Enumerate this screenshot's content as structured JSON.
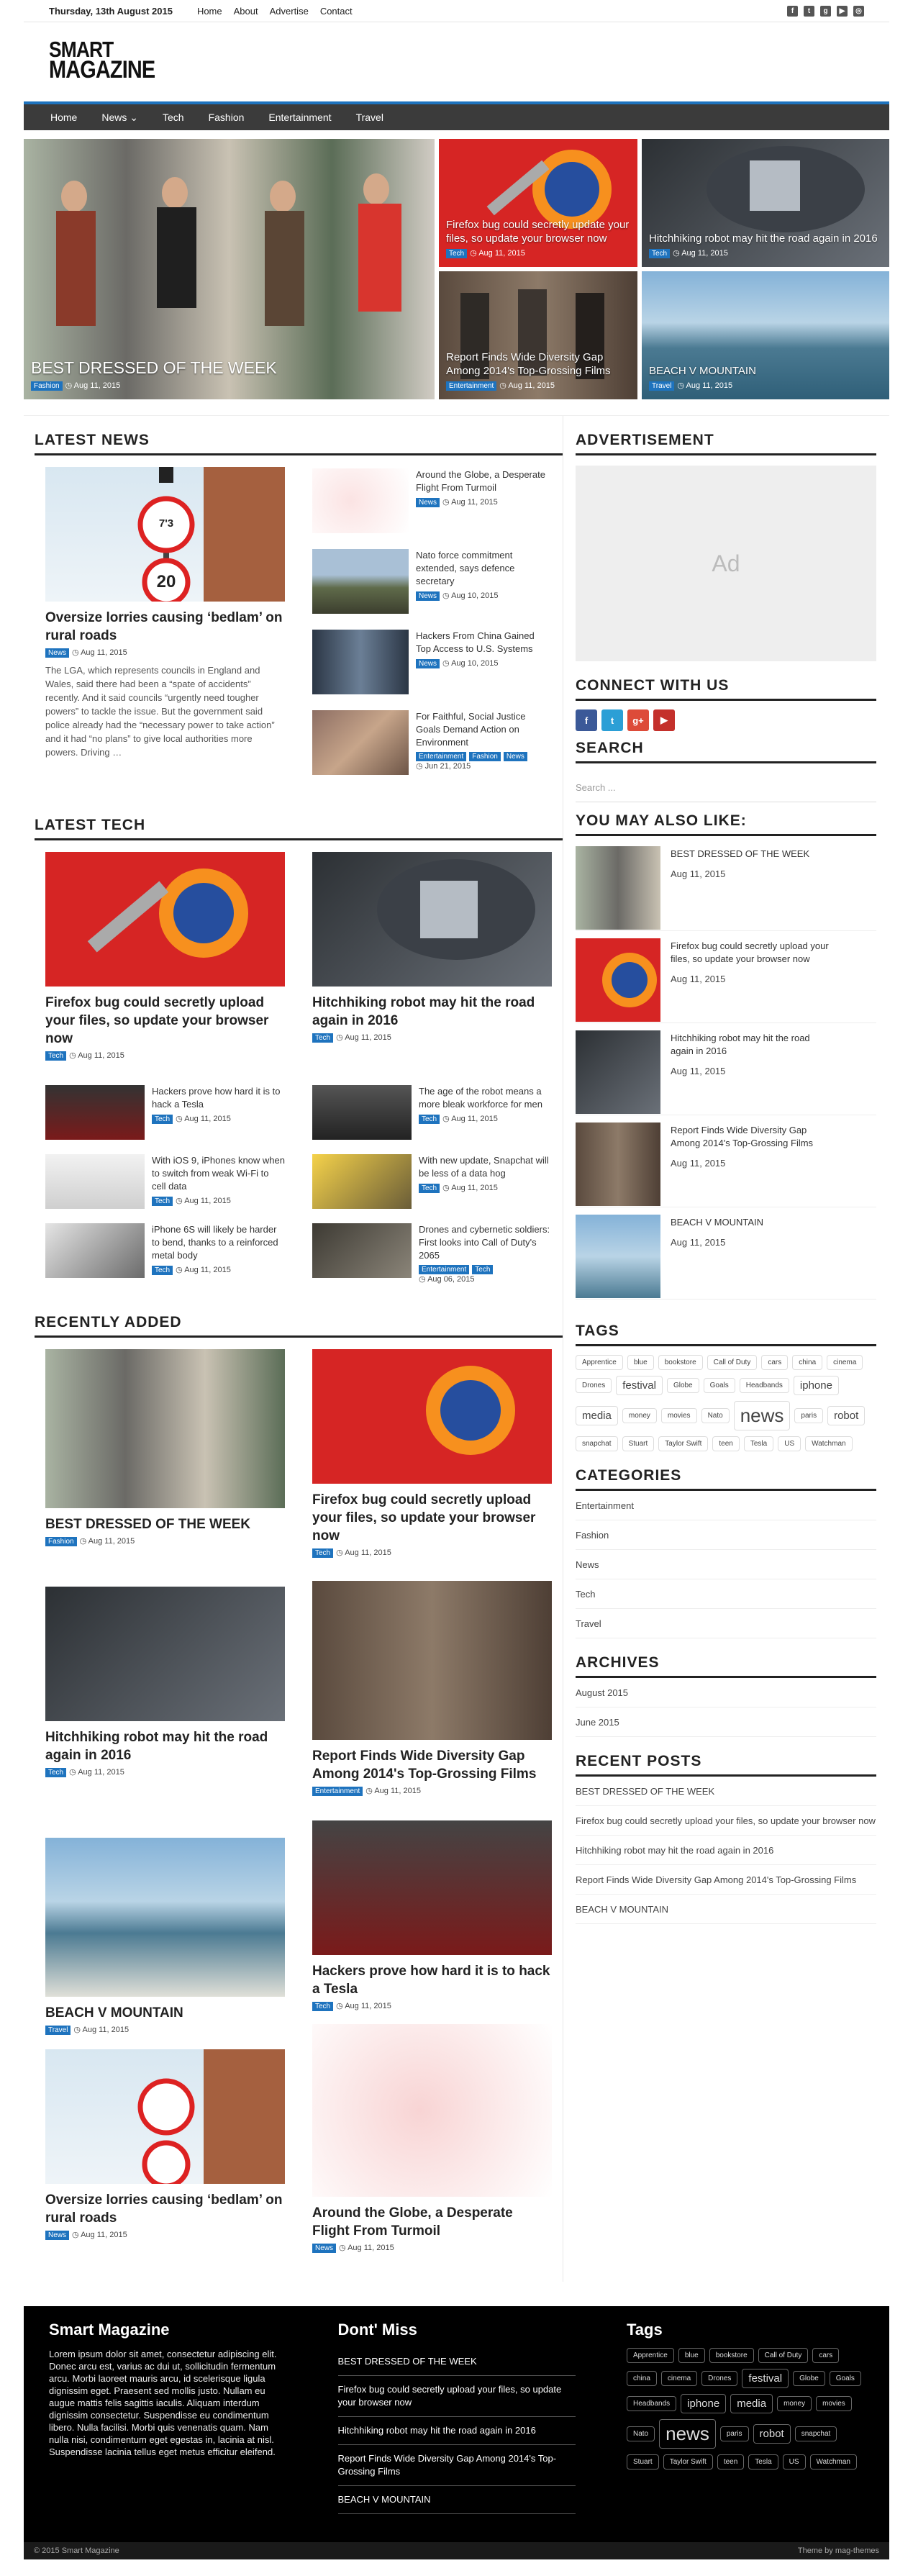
{
  "topbar": {
    "date": "Thursday, 13th August 2015",
    "links": [
      "Home",
      "About",
      "Advertise",
      "Contact"
    ],
    "social_icons": [
      "facebook-icon",
      "twitter-icon",
      "google-plus-icon",
      "youtube-icon",
      "instagram-icon"
    ]
  },
  "logo": {
    "line1": "SMART",
    "line2": "MAGAZINE"
  },
  "nav": {
    "items": [
      "Home",
      "News",
      "Tech",
      "Fashion",
      "Entertainment",
      "Travel"
    ],
    "dropdown_marker": "⌄"
  },
  "featured": [
    {
      "title": "BEST DRESSED OF THE WEEK",
      "tag": "Fashion",
      "date": "Aug 11, 2015"
    },
    {
      "title": "Firefox bug could secretly update your files, so update your browser now",
      "tag": "Tech",
      "date": "Aug 11, 2015"
    },
    {
      "title": "Hitchhiking robot may hit the road again in 2016",
      "tag": "Tech",
      "date": "Aug 11, 2015"
    },
    {
      "title": "Report Finds Wide Diversity Gap Among 2014's Top-Grossing Films",
      "tag": "Entertainment",
      "date": "Aug 11, 2015"
    },
    {
      "title": "BEACH V MOUNTAIN",
      "tag": "Travel",
      "date": "Aug 11, 2015"
    }
  ],
  "latest_news": {
    "title": "LATEST NEWS",
    "main": {
      "title": "Oversize lorries causing ‘bedlam’ on rural roads",
      "tag": "News",
      "date": "Aug 11, 2015",
      "excerpt": "The LGA, which represents councils in England and Wales, said there had been a “spate of accidents” recently. And it said councils “urgently need tougher powers” to tackle the issue. But the government said police already had the “necessary power to take action” and it had “no plans” to give local authorities more powers. Driving …",
      "sign_top": "7'3",
      "sign_bottom": "20"
    },
    "items": [
      {
        "title": "Around the Globe, a Desperate Flight From Turmoil",
        "tags": [
          "News"
        ],
        "date": "Aug 11, 2015"
      },
      {
        "title": "Nato force commitment extended, says defence secretary",
        "tags": [
          "News"
        ],
        "date": "Aug 10, 2015"
      },
      {
        "title": "Hackers From China Gained Top Access to U.S. Systems",
        "tags": [
          "News"
        ],
        "date": "Aug 10, 2015"
      },
      {
        "title": "For Faithful, Social Justice Goals Demand Action on Environment",
        "tags": [
          "Entertainment",
          "Fashion",
          "News"
        ],
        "date": "Jun 21, 2015"
      }
    ]
  },
  "latest_tech": {
    "title": "LATEST TECH",
    "main": [
      {
        "title": "Firefox bug could secretly upload your files, so update your browser now",
        "tag": "Tech",
        "date": "Aug 11, 2015"
      },
      {
        "title": "Hitchhiking robot may hit the road again in 2016",
        "tag": "Tech",
        "date": "Aug 11, 2015"
      }
    ],
    "left": [
      {
        "title": "Hackers prove how hard it is to hack a Tesla",
        "tags": [
          "Tech"
        ],
        "date": "Aug 11, 2015"
      },
      {
        "title": "With iOS 9, iPhones know when to switch from weak Wi-Fi to cell data",
        "tags": [
          "Tech"
        ],
        "date": "Aug 11, 2015"
      },
      {
        "title": "iPhone 6S will likely be harder to bend, thanks to a reinforced metal body",
        "tags": [
          "Tech"
        ],
        "date": "Aug 11, 2015"
      }
    ],
    "right": [
      {
        "title": "The age of the robot means a more bleak workforce for men",
        "tags": [
          "Tech"
        ],
        "date": "Aug 11, 2015"
      },
      {
        "title": "With new update, Snapchat will be less of a data hog",
        "tags": [
          "Tech"
        ],
        "date": "Aug 11, 2015"
      },
      {
        "title": "Drones and cybernetic soldiers: First looks into Call of Duty's 2065",
        "tags": [
          "Entertainment",
          "Tech"
        ],
        "date": "Aug 06, 2015"
      }
    ]
  },
  "recently_added": {
    "title": "RECENTLY ADDED",
    "items": [
      {
        "title": "BEST DRESSED OF THE WEEK",
        "tag": "Fashion",
        "date": "Aug 11, 2015"
      },
      {
        "title": "Firefox bug could secretly upload your files, so update your browser now",
        "tag": "Tech",
        "date": "Aug 11, 2015"
      },
      {
        "title": "Hitchhiking robot may hit the road again in 2016",
        "tag": "Tech",
        "date": "Aug 11, 2015"
      },
      {
        "title": "Report Finds Wide Diversity Gap Among 2014's Top-Grossing Films",
        "tag": "Entertainment",
        "date": "Aug 11, 2015"
      },
      {
        "title": "BEACH V MOUNTAIN",
        "tag": "Travel",
        "date": "Aug 11, 2015"
      },
      {
        "title": "Hackers prove how hard it is to hack a Tesla",
        "tag": "Tech",
        "date": "Aug 11, 2015"
      },
      {
        "title": "Oversize lorries causing ‘bedlam’ on rural roads",
        "tag": "News",
        "date": "Aug 11, 2015"
      },
      {
        "title": "Around the Globe, a Desperate Flight From Turmoil",
        "tag": "News",
        "date": "Aug 11, 2015"
      }
    ]
  },
  "sidebar": {
    "ad_title": "ADVERTISEMENT",
    "ad_label": "Ad",
    "connect_title": "CONNECT WITH US",
    "connect_icons": [
      "f",
      "t",
      "g+",
      "▶"
    ],
    "search_title": "SEARCH",
    "search_placeholder": "Search ...",
    "ymal_title": "YOU MAY ALSO LIKE:",
    "ymal": [
      {
        "title": "BEST DRESSED OF THE WEEK",
        "date": "Aug 11, 2015"
      },
      {
        "title": "Firefox bug could secretly upload your files, so update your browser now",
        "date": "Aug 11, 2015"
      },
      {
        "title": "Hitchhiking robot may hit the road again in 2016",
        "date": "Aug 11, 2015"
      },
      {
        "title": "Report Finds Wide Diversity Gap Among 2014's Top-Grossing Films",
        "date": "Aug 11, 2015"
      },
      {
        "title": "BEACH V MOUNTAIN",
        "date": "Aug 11, 2015"
      }
    ],
    "tags_title": "TAGS",
    "tags": [
      "Apprentice",
      "blue",
      "bookstore",
      "Call of Duty",
      "cars",
      "china",
      "cinema",
      "Drones",
      "festival",
      "Globe",
      "Goals",
      "Headbands",
      "iphone",
      "media",
      "money",
      "movies",
      "Nato",
      "news",
      "paris",
      "robot",
      "snapchat",
      "Stuart",
      "Taylor Swift",
      "teen",
      "Tesla",
      "US",
      "Watchman"
    ],
    "categories_title": "CATEGORIES",
    "categories": [
      "Entertainment",
      "Fashion",
      "News",
      "Tech",
      "Travel"
    ],
    "archives_title": "ARCHIVES",
    "archives": [
      "August 2015",
      "June 2015"
    ],
    "recent_title": "RECENT POSTS",
    "recent": [
      "BEST DRESSED OF THE WEEK",
      "Firefox bug could secretly upload your files, so update your browser now",
      "Hitchhiking robot may hit the road again in 2016",
      "Report Finds Wide Diversity Gap Among 2014's Top-Grossing Films",
      "BEACH V MOUNTAIN"
    ]
  },
  "footer": {
    "about_title": "Smart Magazine",
    "about_text": "Lorem ipsum dolor sit amet, consectetur adipiscing elit. Donec arcu est, varius ac dui ut, sollicitudin fermentum arcu. Morbi laoreet mauris arcu, id scelerisque ligula dignissim eget. Praesent sed mollis justo. Nullam eu augue mattis felis sagittis iaculis. Aliquam interdum dignissim consectetur. Suspendisse eu condimentum libero. Nulla facilisi. Morbi quis venenatis quam. Nam nulla nisi, condimentum eget egestas in, lacinia at nisl. Suspendisse lacinia tellus eget metus efficitur eleifend.",
    "dont_miss_title": "Dont' Miss",
    "dont_miss": [
      "BEST DRESSED OF THE WEEK",
      "Firefox bug could secretly upload your files, so update your browser now",
      "Hitchhiking robot may hit the road again in 2016",
      "Report Finds Wide Diversity Gap Among 2014's Top-Grossing Films",
      "BEACH V MOUNTAIN"
    ],
    "tags_title": "Tags",
    "copyright": "© 2015 Smart Magazine",
    "credit": "Theme by mag-themes"
  }
}
